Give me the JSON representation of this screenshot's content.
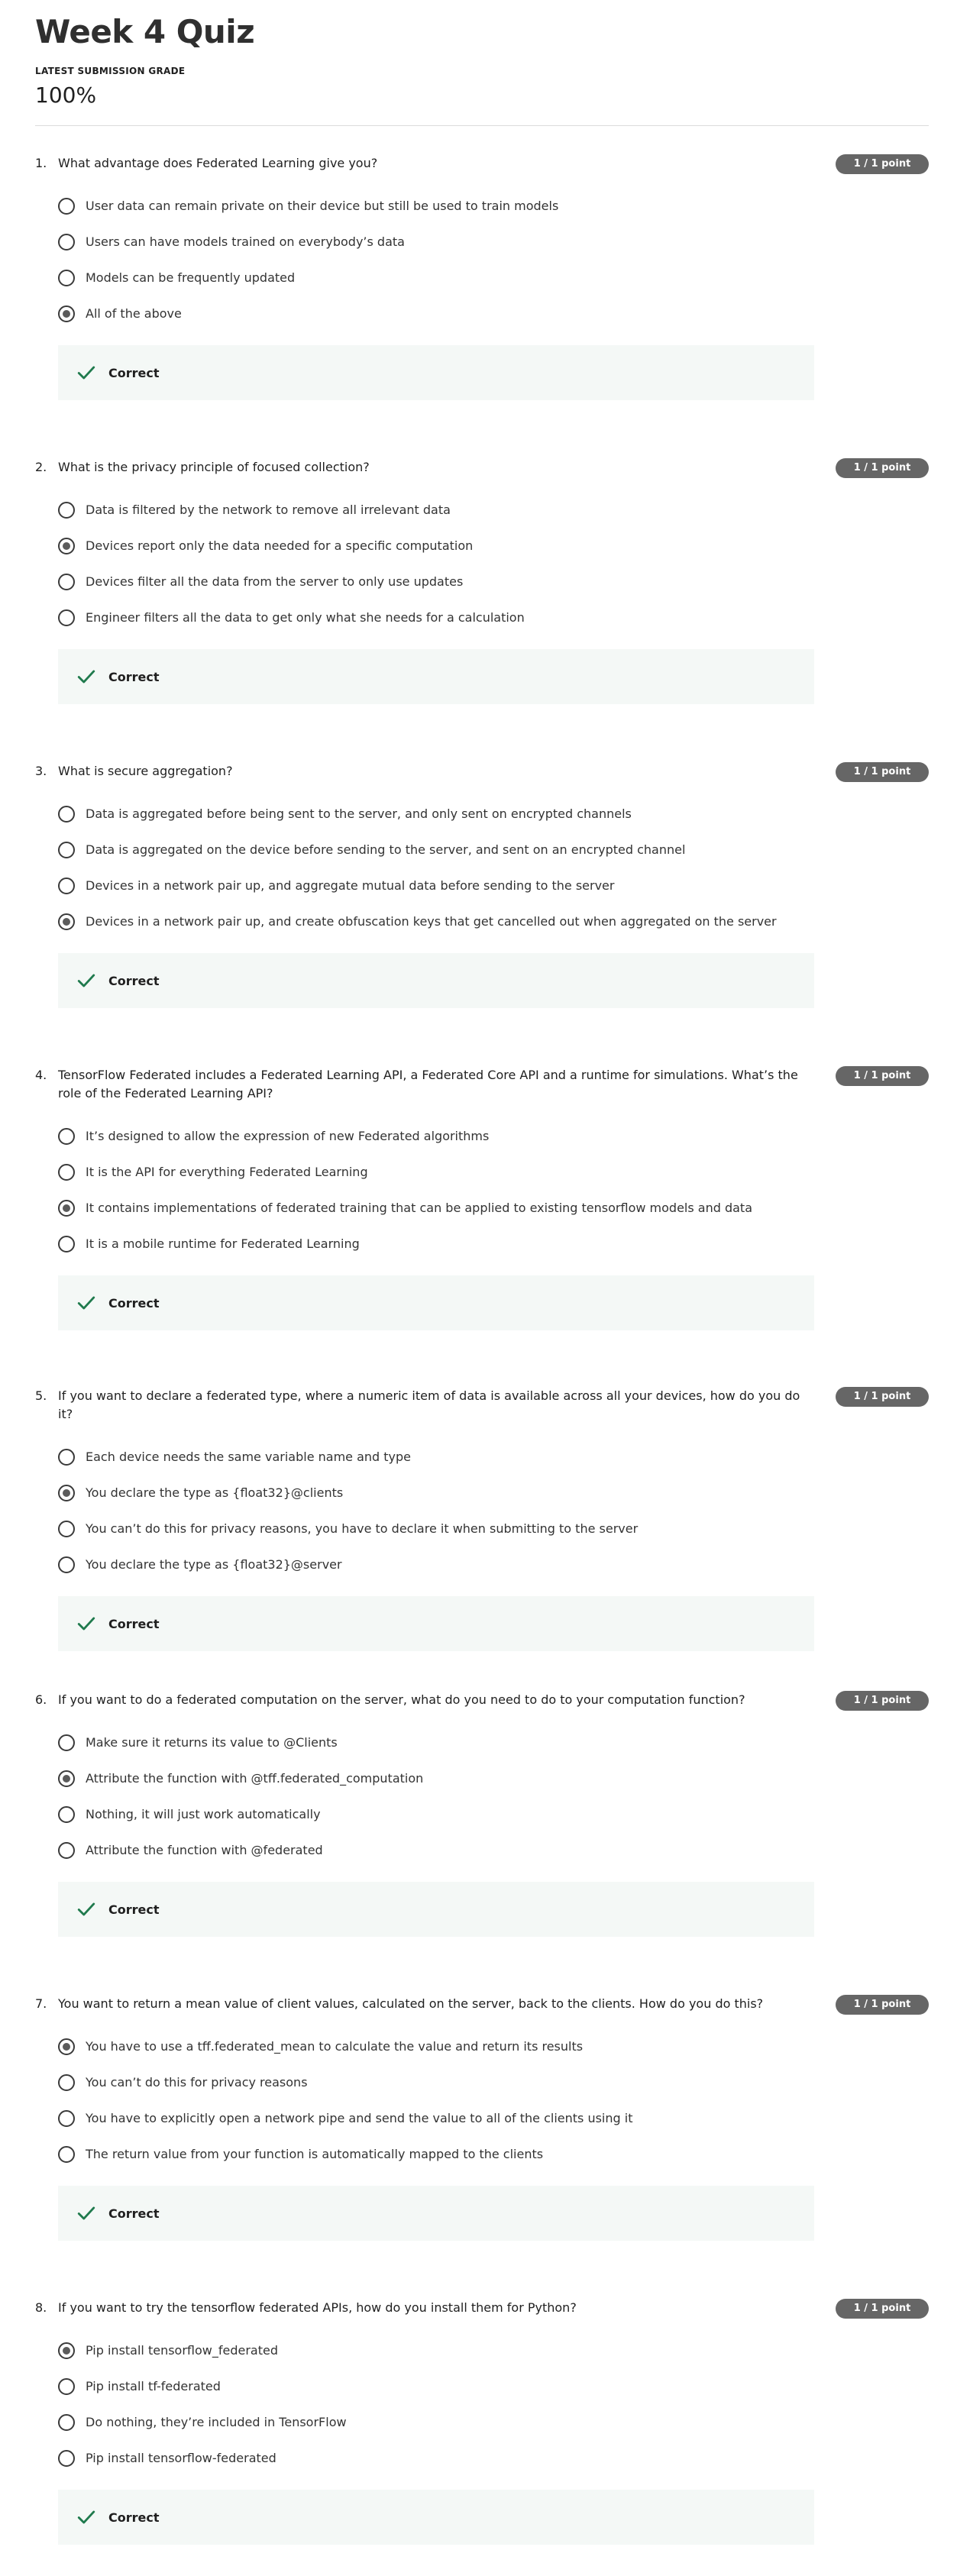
{
  "quiz": {
    "title": "Week 4 Quiz",
    "grade_label": "LATEST SUBMISSION GRADE",
    "grade_value": "100%"
  },
  "colors": {
    "points_badge": "#666666",
    "feedback_bg": "#f4f8f6",
    "check": "#1f7a4d"
  },
  "questions": [
    {
      "number": "1.",
      "text": "What advantage does Federated Learning give you?",
      "points": "1 / 1 point",
      "options": [
        {
          "label": "User data can remain private on their device but still be used to train models",
          "selected": false
        },
        {
          "label": "Users can have models trained on everybody’s data",
          "selected": false
        },
        {
          "label": "Models can be frequently updated",
          "selected": false
        },
        {
          "label": "All of the above",
          "selected": true
        }
      ],
      "feedback": "Correct"
    },
    {
      "number": "2.",
      "text": "What is the privacy principle of focused collection?",
      "points": "1 / 1 point",
      "options": [
        {
          "label": "Data is filtered by the network to remove all irrelevant data",
          "selected": false
        },
        {
          "label": "Devices report only the data needed for a specific computation",
          "selected": true
        },
        {
          "label": "Devices filter all the data from the server to only use updates",
          "selected": false
        },
        {
          "label": "Engineer filters all the data to get only what she needs for a calculation",
          "selected": false
        }
      ],
      "feedback": "Correct"
    },
    {
      "number": "3.",
      "text": "What is secure aggregation?",
      "points": "1 / 1 point",
      "options": [
        {
          "label": "Data is aggregated before being sent to the server, and only sent on encrypted channels",
          "selected": false
        },
        {
          "label": "Data is aggregated on the device before sending to the server, and sent on an encrypted channel",
          "selected": false
        },
        {
          "label": "Devices in a network pair up, and aggregate mutual data before sending to the server",
          "selected": false
        },
        {
          "label": "Devices in a network pair up, and create obfuscation keys that get cancelled out when aggregated on the server",
          "selected": true
        }
      ],
      "feedback": "Correct"
    },
    {
      "number": "4.",
      "text": "TensorFlow Federated includes a Federated Learning API, a Federated Core API and a runtime for simulations. What’s the role of the Federated Learning API?",
      "points": "1 / 1 point",
      "options": [
        {
          "label": "It’s designed to allow the expression of new Federated algorithms",
          "selected": false
        },
        {
          "label": "It is the API for everything Federated Learning",
          "selected": false
        },
        {
          "label": "It contains implementations of federated training that can be applied to existing tensorflow models and data",
          "selected": true
        },
        {
          "label": "It is a mobile runtime for Federated Learning",
          "selected": false
        }
      ],
      "feedback": "Correct"
    },
    {
      "number": "5.",
      "text": "If you want to declare a federated type, where a numeric item of data is available across all your devices, how do you do it?",
      "points": "1 / 1 point",
      "options": [
        {
          "label": "Each device needs the same variable name and type",
          "selected": false
        },
        {
          "label": "You declare the type as {float32}@clients",
          "selected": true
        },
        {
          "label": "You can’t do this for privacy reasons, you have to declare it when submitting to the server",
          "selected": false
        },
        {
          "label": "You declare the type as {float32}@server",
          "selected": false
        }
      ],
      "feedback": "Correct"
    },
    {
      "number": "6.",
      "text": "If you want to do a federated computation on the server, what do you need to do to your computation function?",
      "points": "1 / 1 point",
      "options": [
        {
          "label": "Make sure it returns its value to @Clients",
          "selected": false
        },
        {
          "label": "Attribute the function with @tff.federated_computation",
          "selected": true
        },
        {
          "label": "Nothing, it will just work automatically",
          "selected": false
        },
        {
          "label": "Attribute the function with @federated",
          "selected": false
        }
      ],
      "feedback": "Correct"
    },
    {
      "number": "7.",
      "text": "You want to return a mean value of client values, calculated on the server, back to the clients. How do you do this?",
      "points": "1 / 1 point",
      "options": [
        {
          "label": "You have to use a tff.federated_mean to calculate the value and return its results",
          "selected": true
        },
        {
          "label": "You can’t do this for privacy reasons",
          "selected": false
        },
        {
          "label": "You have to explicitly open a network pipe and send the value to all of the clients using it",
          "selected": false
        },
        {
          "label": "The return value from your function is automatically mapped to the clients",
          "selected": false
        }
      ],
      "feedback": "Correct"
    },
    {
      "number": "8.",
      "text": "If you want to try the tensorflow federated APIs, how do you install them for Python?",
      "points": "1 / 1 point",
      "options": [
        {
          "label": "Pip install tensorflow_federated",
          "selected": true
        },
        {
          "label": "Pip install tf-federated",
          "selected": false
        },
        {
          "label": "Do nothing, they’re included in TensorFlow",
          "selected": false
        },
        {
          "label": "Pip install tensorflow-federated",
          "selected": false
        }
      ],
      "feedback": "Correct"
    }
  ]
}
